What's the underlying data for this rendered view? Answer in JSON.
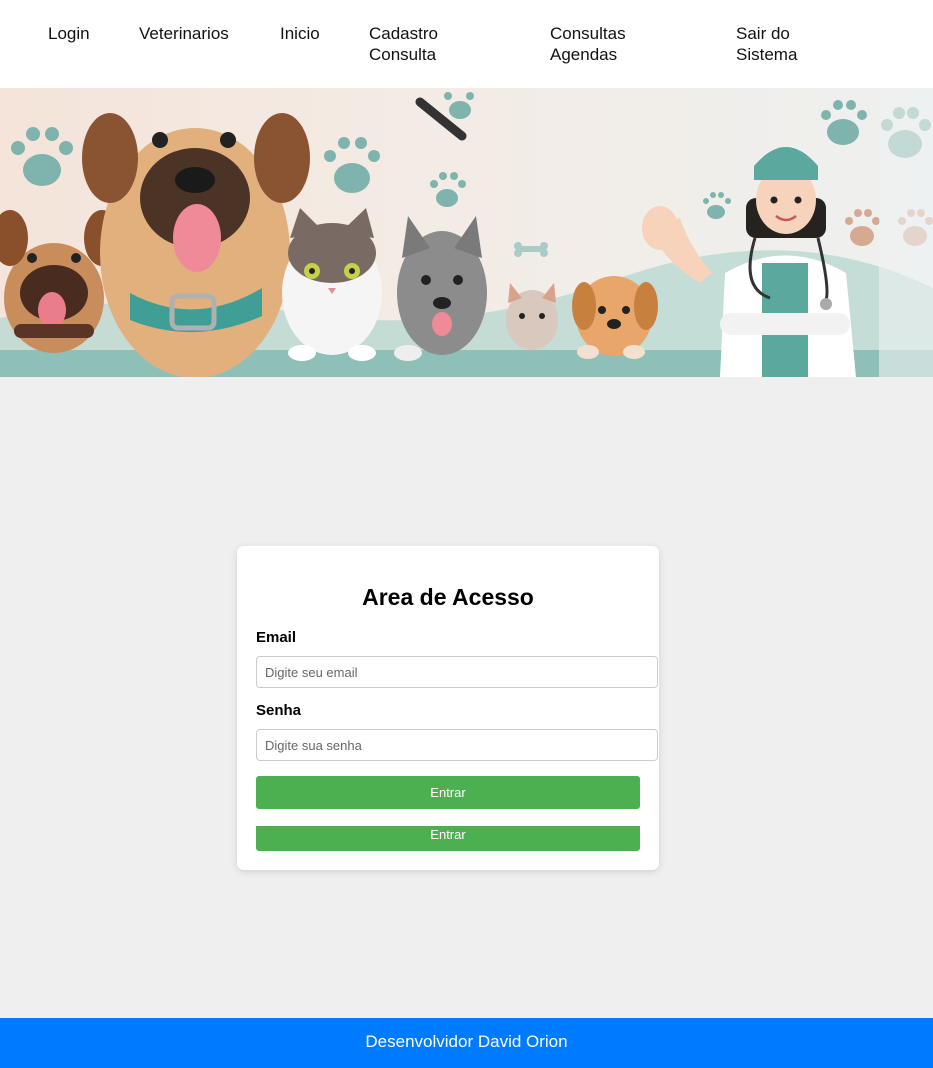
{
  "nav": {
    "login": "Login",
    "veterinarios": "Veterinarios",
    "inicio": "Inicio",
    "cadastro_line1": "Cadastro",
    "cadastro_line2": "Consulta",
    "consultas_line1": "Consultas",
    "consultas_line2": "Agendas",
    "sair_line1": "Sair do",
    "sair_line2": "Sistema"
  },
  "banner": {
    "description_icons": [
      "dog-icon",
      "cat-icon",
      "paw-icon",
      "bone-icon",
      "veterinarian-icon"
    ],
    "colors": {
      "teal": "#8ec0b8",
      "paw": "#7fb3ad",
      "peach": "#f3e3d9"
    }
  },
  "login": {
    "title": "Area de Acesso",
    "email_label": "Email",
    "email_placeholder": "Digite seu email",
    "password_label": "Senha",
    "password_placeholder": "Digite sua senha",
    "submit_label": "Entrar",
    "submit_label_2": "Entrar"
  },
  "footer": {
    "text": "Desenvolvidor David Orion"
  },
  "colors": {
    "accent_green": "#4caf50",
    "footer_blue": "#007bff",
    "page_bg": "#efefef"
  }
}
